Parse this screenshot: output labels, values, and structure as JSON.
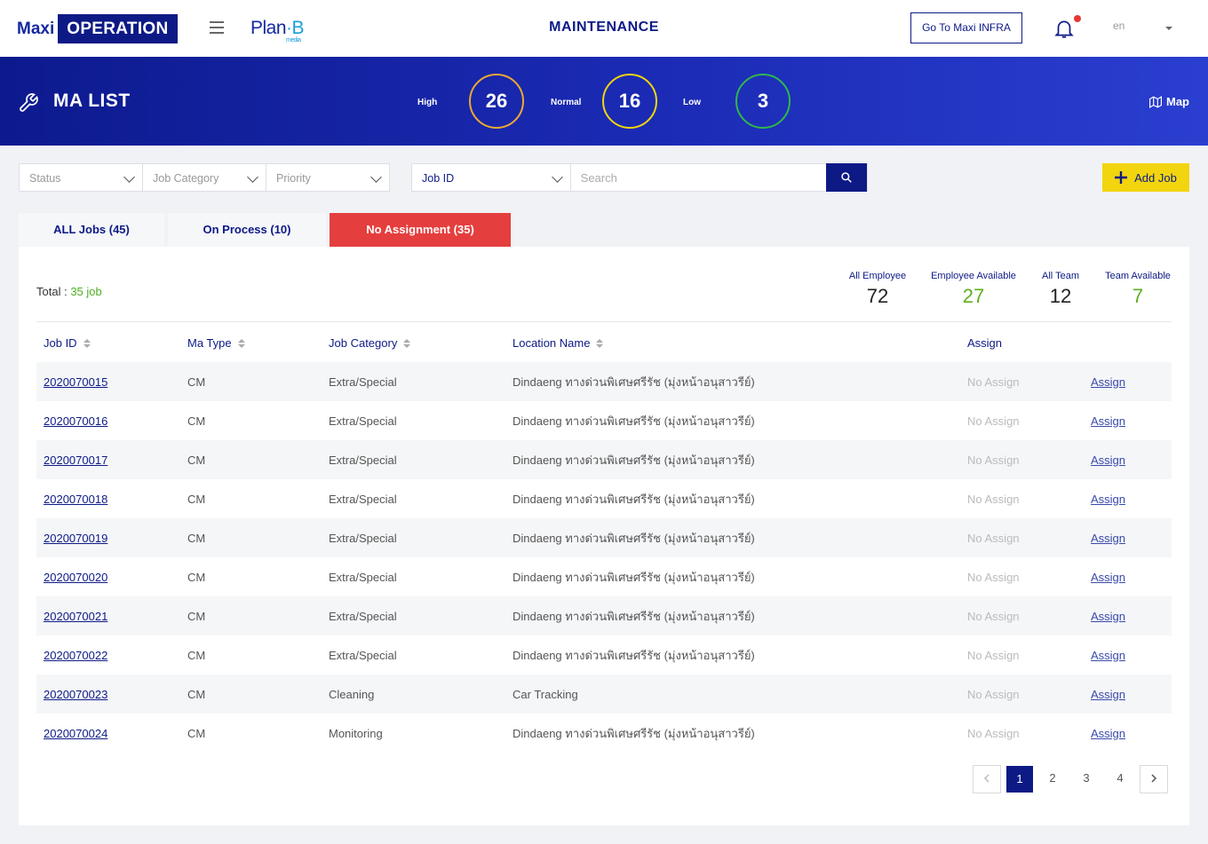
{
  "header": {
    "logo_maxi": "Maxi",
    "logo_operation": "OPERATION",
    "planb_text": "Plan",
    "planb_suffix": "B",
    "planb_media": "media",
    "page_title": "MAINTENANCE",
    "infra_button": "Go To Maxi INFRA",
    "language": "en"
  },
  "banner": {
    "title": "MA LIST",
    "priorities": [
      {
        "label": "High",
        "count": "26",
        "color": "#f0a830"
      },
      {
        "label": "Normal",
        "count": "16",
        "color": "#f2d50e"
      },
      {
        "label": "Low",
        "count": "3",
        "color": "#2eb84a"
      }
    ],
    "map_label": "Map"
  },
  "filters": {
    "status": "Status",
    "job_category": "Job Category",
    "priority": "Priority",
    "search_field": "Job ID",
    "search_placeholder": "Search",
    "add_job": "Add Job"
  },
  "tabs": [
    {
      "label": "ALL Jobs (45)",
      "active": false
    },
    {
      "label": "On Process (10)",
      "active": false
    },
    {
      "label": "No Assignment (35)",
      "active": true
    }
  ],
  "summary": {
    "total_label": "Total :",
    "total_value": "35 job",
    "stats": [
      {
        "label": "All Employee",
        "value": "72"
      },
      {
        "label": "Employee Available",
        "value": "27"
      },
      {
        "label": "All Team",
        "value": "12"
      },
      {
        "label": "Team Available",
        "value": "7"
      }
    ]
  },
  "table": {
    "headers": [
      "Job ID",
      "Ma Type",
      "Job Category",
      "Location Name",
      "Assign"
    ],
    "rows": [
      {
        "job_id": "2020070015",
        "ma_type": "CM",
        "category": "Extra/Special",
        "location": "Dindaeng ทางด่วนพิเศษศรีรัช (มุ่งหน้าอนุสาวรีย์)",
        "assign_status": "No Assign",
        "assign_link": "Assign"
      },
      {
        "job_id": "2020070016",
        "ma_type": "CM",
        "category": "Extra/Special",
        "location": "Dindaeng ทางด่วนพิเศษศรีรัช (มุ่งหน้าอนุสาวรีย์)",
        "assign_status": "No Assign",
        "assign_link": "Assign"
      },
      {
        "job_id": "2020070017",
        "ma_type": "CM",
        "category": "Extra/Special",
        "location": "Dindaeng ทางด่วนพิเศษศรีรัช (มุ่งหน้าอนุสาวรีย์)",
        "assign_status": "No Assign",
        "assign_link": "Assign"
      },
      {
        "job_id": "2020070018",
        "ma_type": "CM",
        "category": "Extra/Special",
        "location": "Dindaeng ทางด่วนพิเศษศรีรัช (มุ่งหน้าอนุสาวรีย์)",
        "assign_status": "No Assign",
        "assign_link": "Assign"
      },
      {
        "job_id": "2020070019",
        "ma_type": "CM",
        "category": "Extra/Special",
        "location": "Dindaeng ทางด่วนพิเศษศรีรัช (มุ่งหน้าอนุสาวรีย์)",
        "assign_status": "No Assign",
        "assign_link": "Assign"
      },
      {
        "job_id": "2020070020",
        "ma_type": "CM",
        "category": "Extra/Special",
        "location": "Dindaeng ทางด่วนพิเศษศรีรัช (มุ่งหน้าอนุสาวรีย์)",
        "assign_status": "No Assign",
        "assign_link": "Assign"
      },
      {
        "job_id": "2020070021",
        "ma_type": "CM",
        "category": "Extra/Special",
        "location": "Dindaeng ทางด่วนพิเศษศรีรัช (มุ่งหน้าอนุสาวรีย์)",
        "assign_status": "No Assign",
        "assign_link": "Assign"
      },
      {
        "job_id": "2020070022",
        "ma_type": "CM",
        "category": "Extra/Special",
        "location": "Dindaeng ทางด่วนพิเศษศรีรัช (มุ่งหน้าอนุสาวรีย์)",
        "assign_status": "No Assign",
        "assign_link": "Assign"
      },
      {
        "job_id": "2020070023",
        "ma_type": "CM",
        "category": "Cleaning",
        "location": "Car Tracking",
        "assign_status": "No Assign",
        "assign_link": "Assign"
      },
      {
        "job_id": "2020070024",
        "ma_type": "CM",
        "category": "Monitoring",
        "location": "Dindaeng ทางด่วนพิเศษศรีรัช (มุ่งหน้าอนุสาวรีย์)",
        "assign_status": "No Assign",
        "assign_link": "Assign"
      }
    ]
  },
  "pagination": {
    "prev_icon": "chevron-left-icon",
    "pages": [
      "1",
      "2",
      "3",
      "4"
    ],
    "current": "1",
    "next_icon": "chevron-right-icon"
  },
  "colors": {
    "brand_navy": "#0d1a86",
    "active_tab": "#e53e3e",
    "add_button": "#f2d50e",
    "available_green": "#5cb020"
  }
}
